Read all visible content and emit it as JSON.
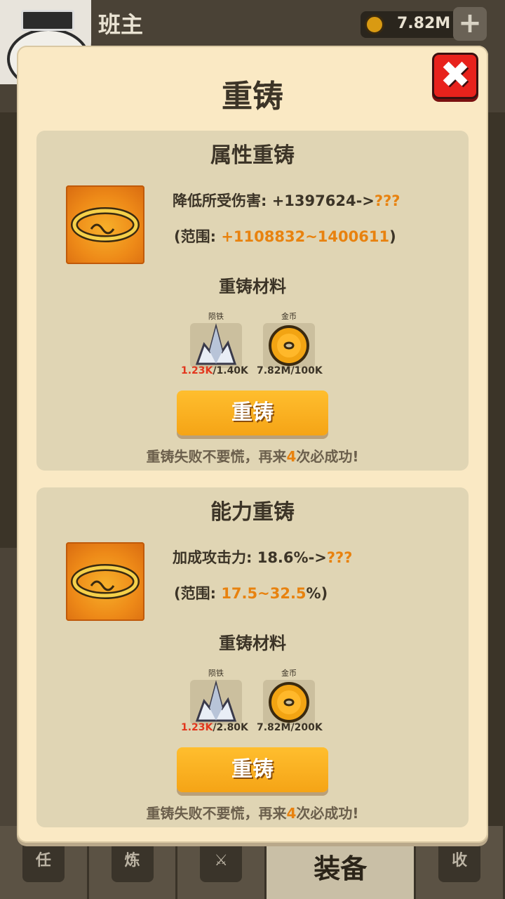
{
  "header": {
    "player_name": "班主",
    "gold_amount": "7.82M",
    "plus_label": "+"
  },
  "nav": {
    "tab1": "任",
    "tab2": "炼",
    "tab4_active": "装备",
    "tab5": "收"
  },
  "modal": {
    "title": "重铸",
    "close_label": "✖",
    "attribute_panel": {
      "title": "属性重铸",
      "stat_prefix": "降低所受伤害: +1397624->",
      "stat_unknown": "???",
      "range_prefix": "(范围: ",
      "range_value": "+1108832~1400611",
      "range_suffix": ")",
      "materials_title": "重铸材料",
      "materials": [
        {
          "name": "陨铁",
          "have": "1.23K",
          "need": "/1.40K"
        },
        {
          "name": "金币",
          "have": "7.82M",
          "need": "/100K"
        }
      ],
      "button_label": "重铸",
      "hint_prefix": "重铸失败不要慌，再来",
      "hint_number": "4",
      "hint_suffix": "次必成功!"
    },
    "ability_panel": {
      "title": "能力重铸",
      "stat_prefix": "加成攻击力: 18.6%->",
      "stat_unknown": "???",
      "range_prefix": "(范围:  ",
      "range_value": "17.5~32.5",
      "range_suffix": "%)",
      "materials_title": "重铸材料",
      "materials": [
        {
          "name": "陨铁",
          "have": "1.23K",
          "need": "/2.80K"
        },
        {
          "name": "金币",
          "have": "7.82M",
          "need": "/200K"
        }
      ],
      "button_label": "重铸",
      "hint_prefix": "重铸失败不要慌，再来",
      "hint_number": "4",
      "hint_suffix": "次必成功!"
    }
  }
}
